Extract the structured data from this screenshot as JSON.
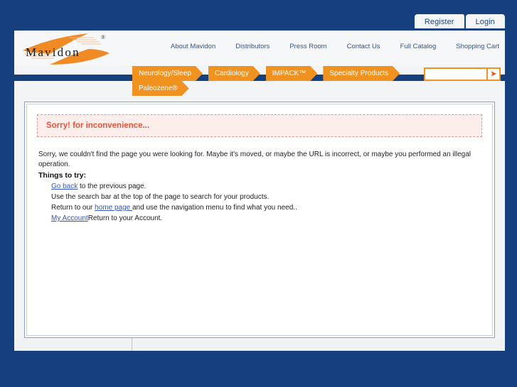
{
  "site": {
    "brand": "Mavidon",
    "brand_trademark": "®",
    "colors": {
      "page_background": "#153f7d",
      "accent_orange": "#f0921f",
      "link_blue": "#2f5596",
      "alert_text": "#e8543a",
      "alert_background": "#fdeeeb"
    }
  },
  "auth_tabs": [
    {
      "label": "Register"
    },
    {
      "label": "Login"
    }
  ],
  "topnav": [
    {
      "label": "About Mavidon"
    },
    {
      "label": "Distributors"
    },
    {
      "label": "Press Room"
    },
    {
      "label": "Contact Us"
    },
    {
      "label": "Full Catalog"
    },
    {
      "label": "Shopping Cart"
    }
  ],
  "product_tabs_row1": [
    {
      "label": "Neurology/Sleep"
    },
    {
      "label": "Cardiology"
    },
    {
      "label": "IMPACK™"
    },
    {
      "label": "Specialty Products"
    }
  ],
  "product_tabs_row2": [
    {
      "label": "Paleozene®"
    }
  ],
  "search": {
    "value": "",
    "placeholder": "",
    "button_label": "➤",
    "button_icon": "search-submit-arrow-icon"
  },
  "alert": {
    "message": "Sorry! for inconvenience..."
  },
  "main": {
    "paragraph": "Sorry, we couldn't find the page you were looking for. Maybe it's moved, or maybe the URL is incorrect, or maybe you performed an illegal operation.",
    "things_to_try_heading": "Things to try:",
    "items": [
      {
        "link": "Go back",
        "text": " to the previous page."
      },
      {
        "link": "",
        "text": "Use the search bar at the top of the page to search for your products."
      },
      {
        "pre": "Return to our ",
        "link": "home page ",
        "text": "and use the navigation menu to find what you need.."
      },
      {
        "link": "My Account",
        "text": "Return to your Account."
      }
    ]
  }
}
